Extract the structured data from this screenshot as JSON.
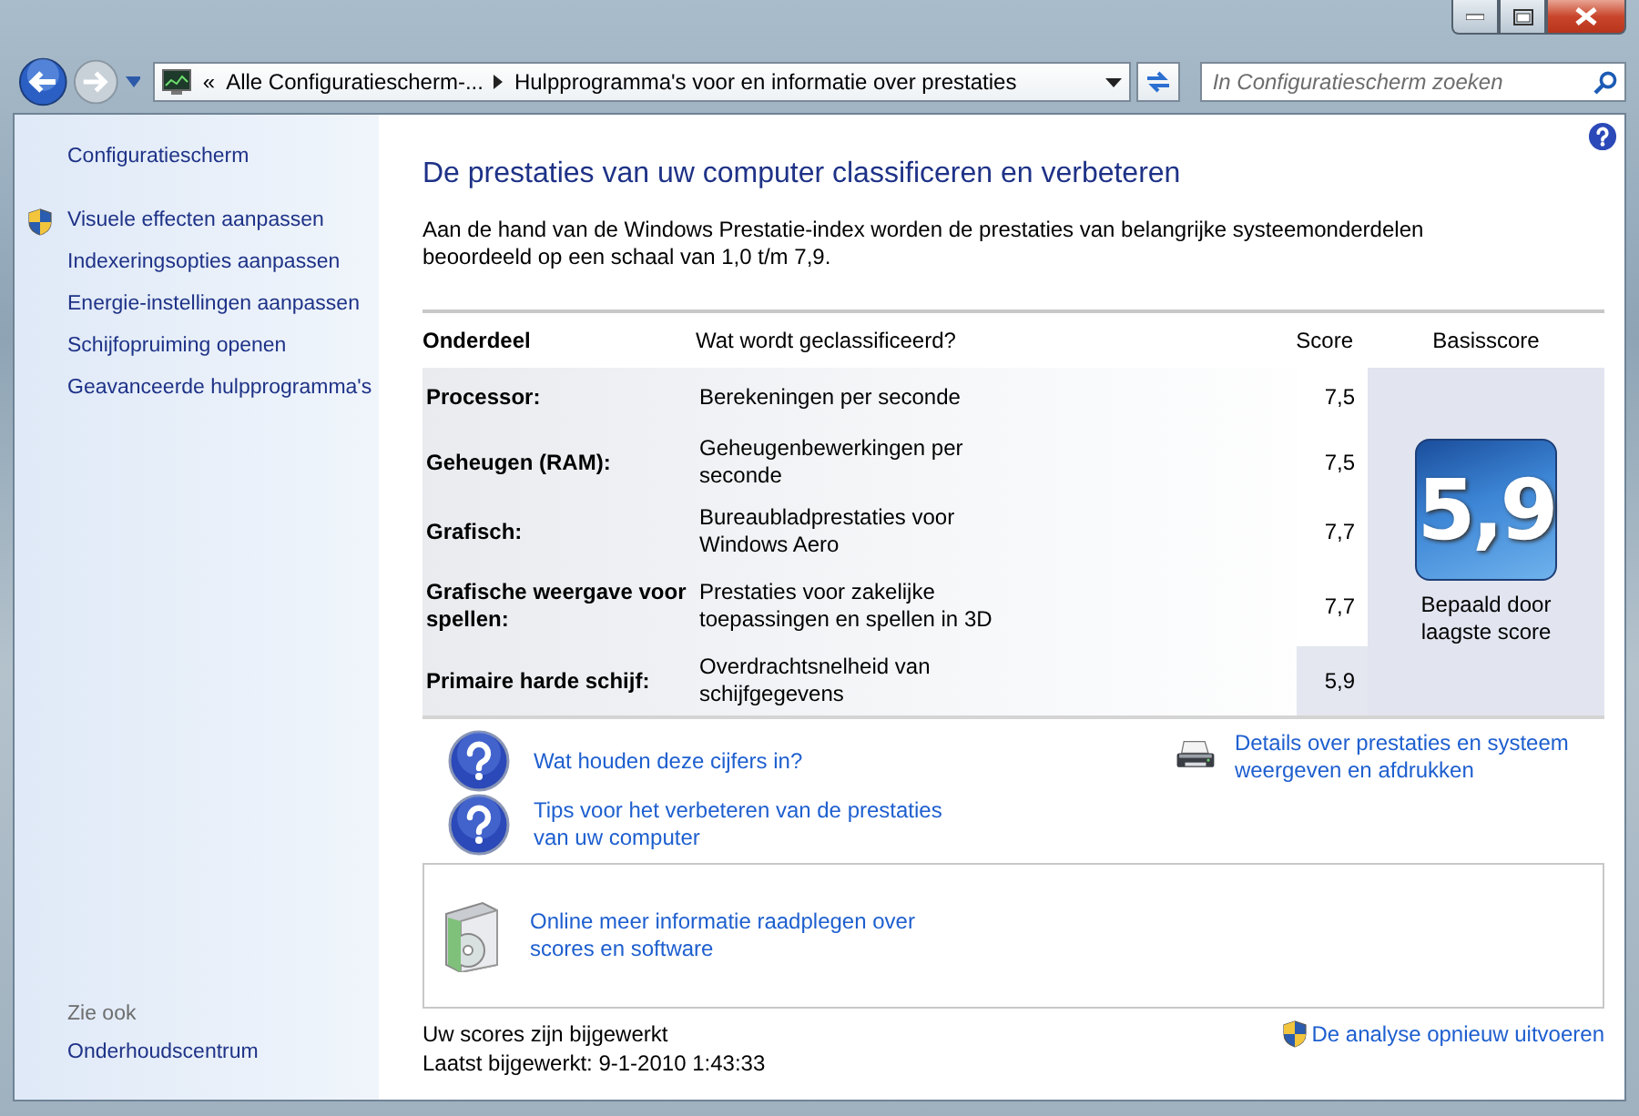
{
  "address_bar": {
    "overflow": "«",
    "crumbs": [
      "Alle Configuratiescherm-...",
      "Hulpprogramma's voor en informatie over prestaties"
    ]
  },
  "search": {
    "placeholder": "In Configuratiescherm zoeken"
  },
  "sidebar": {
    "home": "Configuratiescherm",
    "items": [
      {
        "label": "Visuele effecten aanpassen",
        "shield": true
      },
      {
        "label": "Indexeringsopties aanpassen",
        "shield": false
      },
      {
        "label": "Energie-instellingen aanpassen",
        "shield": false
      },
      {
        "label": "Schijfopruiming openen",
        "shield": false
      },
      {
        "label": "Geavanceerde hulpprogramma's",
        "shield": false
      }
    ],
    "see_also": {
      "heading": "Zie ook",
      "items": [
        "Onderhoudscentrum"
      ]
    }
  },
  "main": {
    "title": "De prestaties van uw computer classificeren en verbeteren",
    "description": "Aan de hand van de Windows Prestatie-index worden de prestaties van belangrijke systeemonderdelen beoordeeld op een schaal van 1,0 t/m 7,9.",
    "table": {
      "columns": [
        "Onderdeel",
        "Wat wordt geclassificeerd?",
        "Score",
        "Basisscore"
      ],
      "rows": [
        {
          "component": "Processor:",
          "rated": "Berekeningen per seconde",
          "score": "7,5",
          "lowest": false
        },
        {
          "component": "Geheugen (RAM):",
          "rated": "Geheugenbewerkingen per seconde",
          "score": "7,5",
          "lowest": false
        },
        {
          "component": "Grafisch:",
          "rated": "Bureaubladprestaties voor Windows Aero",
          "score": "7,7",
          "lowest": false
        },
        {
          "component": "Grafische weergave voor spellen:",
          "rated": "Prestaties voor zakelijke toepassingen en spellen in 3D",
          "score": "7,7",
          "lowest": false
        },
        {
          "component": "Primaire harde schijf:",
          "rated": "Overdrachtsnelheid van schijfgegevens",
          "score": "5,9",
          "lowest": true
        }
      ],
      "base_score": {
        "value": "5,9",
        "caption": "Bepaald door laagste score"
      }
    },
    "help_links": [
      "Wat houden deze cijfers in?",
      "Tips voor het verbeteren van de prestaties van uw computer"
    ],
    "print_link": "Details over prestaties en systeem weergeven en afdrukken",
    "online_link": "Online meer informatie raadplegen over scores en software",
    "status": [
      "Uw scores zijn bijgewerkt",
      "Laatst bijgewerkt: 9-1-2010 1:43:33"
    ],
    "rerun": {
      "label": "De analyse opnieuw uitvoeren",
      "shield": true
    }
  }
}
